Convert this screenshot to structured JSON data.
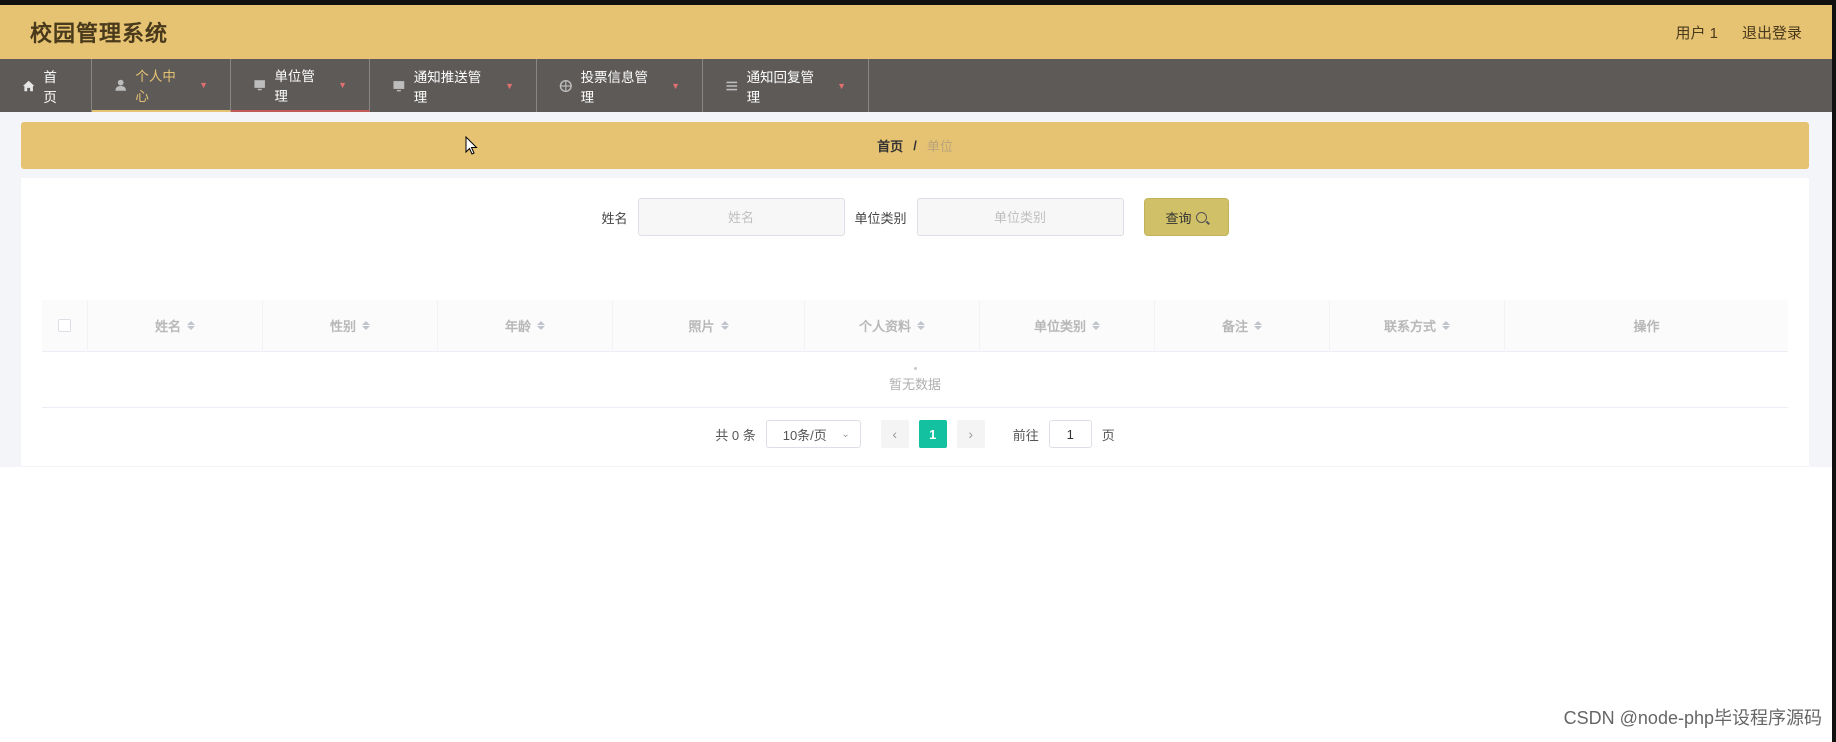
{
  "header": {
    "title": "校园管理系统",
    "user_label": "用户 1",
    "logout_label": "退出登录"
  },
  "nav": {
    "items": [
      {
        "label": "首页",
        "icon": "home-icon",
        "caret": false
      },
      {
        "label": "个人中心",
        "icon": "user-icon",
        "caret": true
      },
      {
        "label": "单位管理",
        "icon": "monitor-icon",
        "caret": true
      },
      {
        "label": "通知推送管理",
        "icon": "monitor-icon",
        "caret": true
      },
      {
        "label": "投票信息管理",
        "icon": "target-icon",
        "caret": true
      },
      {
        "label": "通知回复管理",
        "icon": "list-icon",
        "caret": true
      }
    ]
  },
  "breadcrumb": {
    "home": "首页",
    "separator": "/",
    "current": "单位"
  },
  "search": {
    "name_label": "姓名",
    "name_placeholder": "姓名",
    "category_label": "单位类别",
    "category_placeholder": "单位类别",
    "button_label": "查询"
  },
  "table": {
    "columns": [
      "姓名",
      "性别",
      "年龄",
      "照片",
      "个人资料",
      "单位类别",
      "备注",
      "联系方式",
      "操作"
    ],
    "empty_text": "暂无数据"
  },
  "pagination": {
    "total_text": "共 0 条",
    "page_size": "10条/页",
    "current_page": "1",
    "goto_prefix": "前往",
    "goto_value": "1",
    "goto_suffix": "页"
  },
  "watermark": "CSDN @node-php毕设程序源码",
  "colors": {
    "header_bg": "#e6c372",
    "nav_bg": "#5d5a58",
    "accent": "#13c1a0",
    "search_button": "#d0c168"
  }
}
